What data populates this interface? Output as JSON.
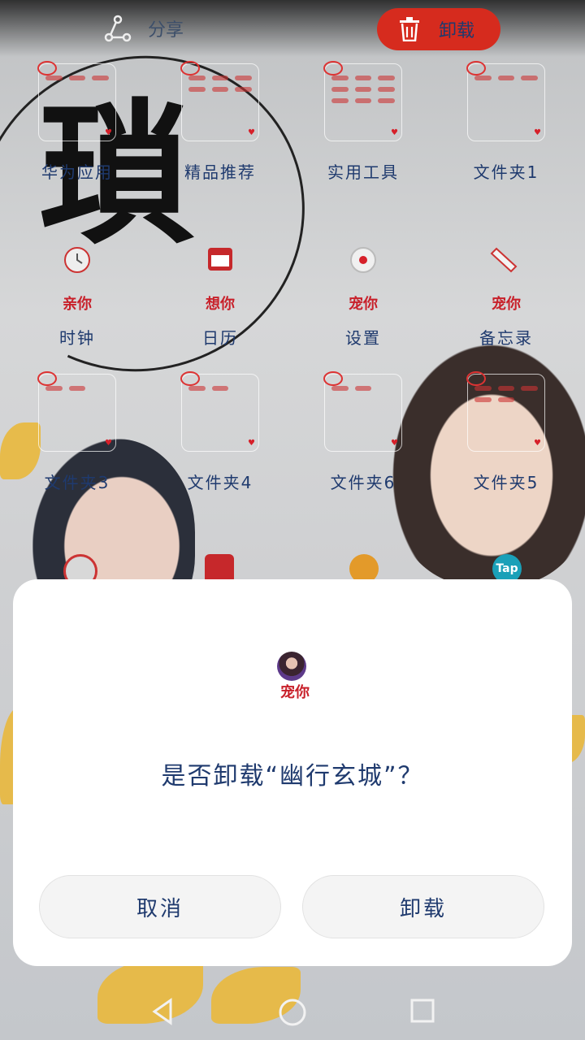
{
  "top_bar": {
    "share_label": "分享",
    "uninstall_label": "卸载",
    "share_icon": "share-icon",
    "uninstall_icon": "trash-icon",
    "accent": "#d62b1e"
  },
  "wallpaper": {
    "big_character": "瑣"
  },
  "apps_row1": [
    {
      "label": "华为应用"
    },
    {
      "label": "精品推荐"
    },
    {
      "label": "实用工具"
    },
    {
      "label": "文件夹1"
    }
  ],
  "apps_row2": [
    {
      "label": "时钟",
      "icon": "clock-icon",
      "sig": "亲你"
    },
    {
      "label": "日历",
      "icon": "calendar-icon",
      "sig": "想你"
    },
    {
      "label": "设置",
      "icon": "gear-icon",
      "sig": "宠你"
    },
    {
      "label": "备忘录",
      "icon": "memo-icon",
      "sig": "宠你"
    }
  ],
  "apps_row3": [
    {
      "label": "文件夹3"
    },
    {
      "label": "文件夹4"
    },
    {
      "label": "文件夹6"
    },
    {
      "label": "文件夹5"
    }
  ],
  "dock_peek": {
    "tap_label": "Tap"
  },
  "dialog": {
    "signature": "宠你",
    "question": "是否卸载“幽行玄城”？",
    "cancel_label": "取消",
    "confirm_label": "卸载"
  },
  "navigation": {
    "back_icon": "back-icon",
    "home_icon": "home-icon",
    "recents_icon": "recents-icon"
  }
}
